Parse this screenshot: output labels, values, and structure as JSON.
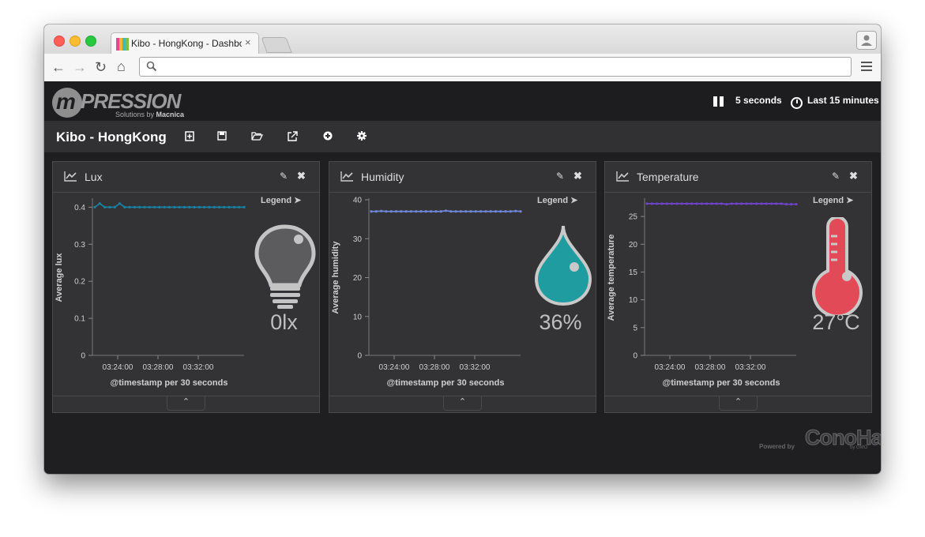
{
  "browser": {
    "tab_title": "Kibo - HongKong - Dashbo",
    "tab_close": "×",
    "url": ""
  },
  "app": {
    "logo_text": "PRESSION",
    "logo_m": "m",
    "logo_sub_prefix": "Solutions by ",
    "logo_sub_brand": "Macnica",
    "refresh_interval": "5 seconds",
    "time_range": "Last 15 minutes"
  },
  "dashboard": {
    "title": "Kibo - HongKong"
  },
  "panels": [
    {
      "title": "Lux",
      "legend": "Legend",
      "value": "0lx",
      "icon": "lightbulb-icon",
      "color": "#1a7fa0",
      "ylabel": "Average lux",
      "xlabel": "@timestamp per 30 seconds"
    },
    {
      "title": "Humidity",
      "legend": "Legend",
      "value": "36%",
      "icon": "water-drop-icon",
      "color": "#6f86d9",
      "ylabel": "Average humidity",
      "xlabel": "@timestamp per 30 seconds"
    },
    {
      "title": "Temperature",
      "legend": "Legend",
      "value": "27°C",
      "icon": "thermometer-icon",
      "color": "#6e43c8",
      "ylabel": "Average temperature",
      "xlabel": "@timestamp per 30 seconds"
    }
  ],
  "chart_data": [
    {
      "type": "line",
      "ylabel": "Average lux",
      "xlabel": "@timestamp per 30 seconds",
      "ylim": [
        0,
        0.42
      ],
      "yticks": [
        "0",
        "0.1",
        "0.2",
        "0.3",
        "0.4"
      ],
      "xticks": [
        "03:24:00",
        "03:28:00",
        "03:32:00"
      ],
      "series": [
        {
          "values": [
            0.4,
            0.41,
            0.4,
            0.4,
            0.4,
            0.41,
            0.4,
            0.4,
            0.4,
            0.4,
            0.4,
            0.4,
            0.4,
            0.4,
            0.4,
            0.4,
            0.4,
            0.4,
            0.4,
            0.4,
            0.4,
            0.4,
            0.4,
            0.4,
            0.4,
            0.4,
            0.4,
            0.4,
            0.4,
            0.4,
            0.4
          ]
        }
      ]
    },
    {
      "type": "line",
      "ylabel": "Average humidity",
      "xlabel": "@timestamp per 30 seconds",
      "ylim": [
        0,
        40
      ],
      "yticks": [
        "0",
        "10",
        "20",
        "30",
        "40"
      ],
      "xticks": [
        "03:24:00",
        "03:28:00",
        "03:32:00"
      ],
      "series": [
        {
          "values": [
            37,
            37,
            37.1,
            37,
            37,
            37,
            37,
            37,
            37,
            37,
            37,
            37,
            37,
            37,
            37,
            37.2,
            37,
            37,
            37,
            37,
            37,
            37,
            37,
            37,
            37,
            37,
            37,
            37,
            37,
            37.1,
            37
          ]
        }
      ]
    },
    {
      "type": "line",
      "ylabel": "Average temperature",
      "xlabel": "@timestamp per 30 seconds",
      "ylim": [
        0,
        28
      ],
      "yticks": [
        "0",
        "5",
        "10",
        "15",
        "20",
        "25"
      ],
      "xticks": [
        "03:24:00",
        "03:28:00",
        "03:32:00"
      ],
      "series": [
        {
          "values": [
            27.3,
            27.3,
            27.3,
            27.3,
            27.3,
            27.3,
            27.3,
            27.3,
            27.3,
            27.3,
            27.3,
            27.3,
            27.3,
            27.3,
            27.3,
            27.3,
            27.2,
            27.3,
            27.3,
            27.3,
            27.3,
            27.3,
            27.3,
            27.3,
            27.3,
            27.3,
            27.3,
            27.3,
            27.2,
            27.2,
            27.2
          ]
        }
      ]
    }
  ],
  "footer": {
    "powered_by": "Powered by",
    "brand": "ConoHa",
    "brand_sub": "by GMO"
  }
}
